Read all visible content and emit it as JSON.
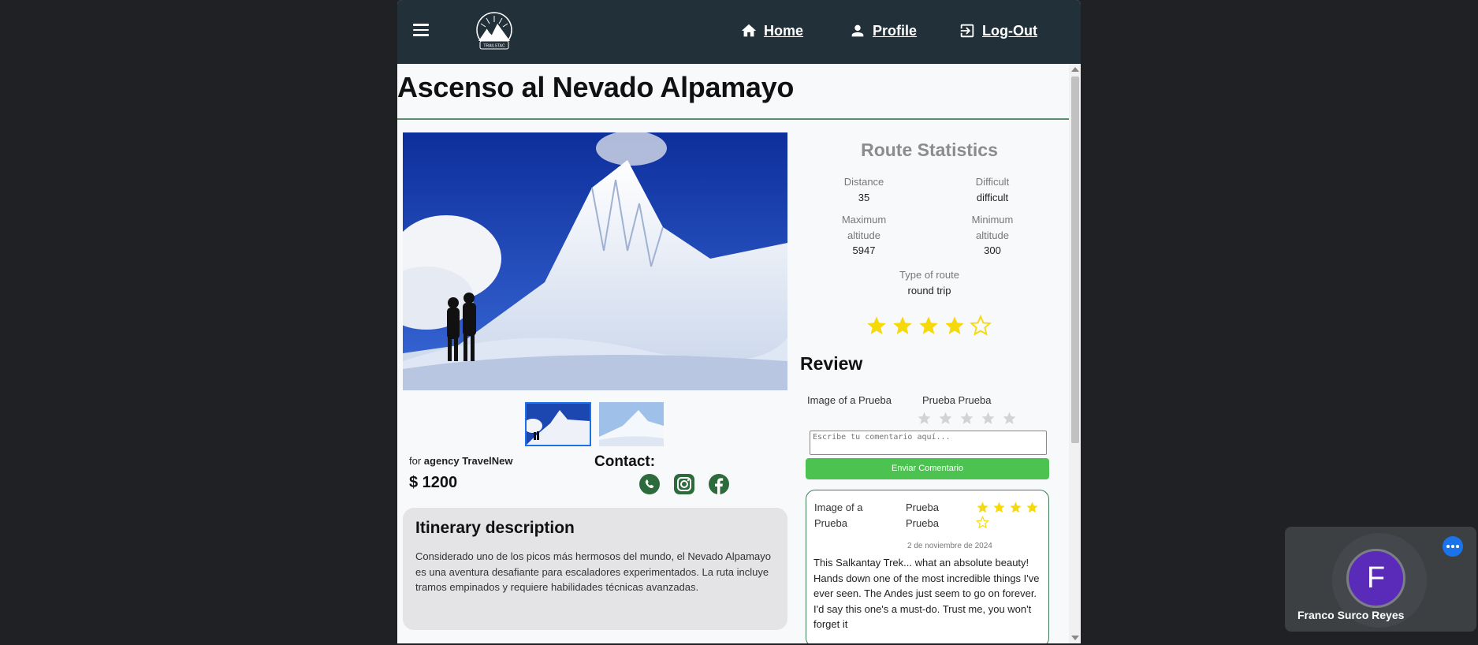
{
  "nav": {
    "home": "Home",
    "profile": "Profile",
    "logout": "Log-Out",
    "logo_text": "TRAILSTAC"
  },
  "route": {
    "title": "Ascenso al Nevado Alpamayo",
    "agency_prefix": "for",
    "agency_name": "agency TravelNew",
    "price": "$ 1200",
    "contact_title": "Contact:"
  },
  "itinerary": {
    "title": "Itinerary description",
    "text": "Considerado uno de los picos más hermosos del mundo, el Nevado Alpamayo es una aventura desafiante para escaladores experimentados. La ruta incluye tramos empinados y requiere habilidades técnicas avanzadas."
  },
  "stats": {
    "title": "Route Statistics",
    "distance_label": "Distance",
    "distance_value": "35",
    "difficult_label": "Difficult",
    "difficult_value": "difficult",
    "max_alt_label": "Maximum altitude",
    "max_alt_value": "5947",
    "min_alt_label": "Minimum altitude",
    "min_alt_value": "300",
    "type_label": "Type of route",
    "type_value": "round trip",
    "rating": 4,
    "rating_max": 5
  },
  "review_form": {
    "title": "Review",
    "image_alt": "Image of a Prueba",
    "user": "Prueba Prueba",
    "placeholder": "Escribe tu comentario aquí...",
    "submit": "Enviar Comentario",
    "rating": 0
  },
  "reviews": [
    {
      "image_alt": "Image of a Prueba",
      "user": "Prueba Prueba",
      "rating": 4,
      "date": "2 de noviembre de 2024",
      "text": "This Salkantay Trek... what an absolute beauty! Hands down one of the most incredible things I've ever seen. The Andes just seem to go on forever. I'd say this one's a must-do. Trust me, you won't forget it"
    }
  ],
  "meeting": {
    "participant_name": "Franco Surco Reyes",
    "avatar_letter": "F"
  },
  "colors": {
    "navbar": "#22303a",
    "accent_green": "#4cc351",
    "star_yellow": "#f5d90a",
    "rule_green": "#5c8b6d"
  }
}
